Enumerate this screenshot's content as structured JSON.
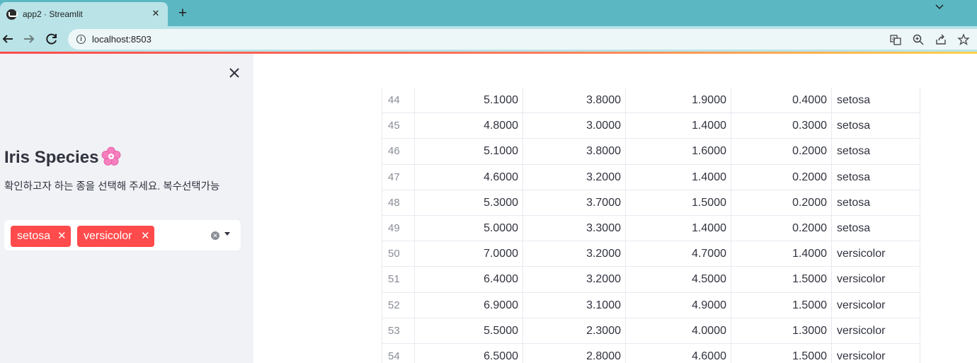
{
  "browser": {
    "tab_title": "app2 · Streamlit",
    "url": "localhost:8503"
  },
  "sidebar": {
    "title": "Iris Species",
    "title_emoji": "cherry-blossom",
    "description": "확인하고자 하는 종을 선택해 주세요. 복수선택가능",
    "multiselect": {
      "selected": [
        "setosa",
        "versicolor"
      ]
    }
  },
  "table": {
    "rows": [
      {
        "idx": "44",
        "c1": "5.1000",
        "c2": "3.8000",
        "c3": "1.9000",
        "c4": "0.4000",
        "species": "setosa"
      },
      {
        "idx": "45",
        "c1": "4.8000",
        "c2": "3.0000",
        "c3": "1.4000",
        "c4": "0.3000",
        "species": "setosa"
      },
      {
        "idx": "46",
        "c1": "5.1000",
        "c2": "3.8000",
        "c3": "1.6000",
        "c4": "0.2000",
        "species": "setosa"
      },
      {
        "idx": "47",
        "c1": "4.6000",
        "c2": "3.2000",
        "c3": "1.4000",
        "c4": "0.2000",
        "species": "setosa"
      },
      {
        "idx": "48",
        "c1": "5.3000",
        "c2": "3.7000",
        "c3": "1.5000",
        "c4": "0.2000",
        "species": "setosa"
      },
      {
        "idx": "49",
        "c1": "5.0000",
        "c2": "3.3000",
        "c3": "1.4000",
        "c4": "0.2000",
        "species": "setosa"
      },
      {
        "idx": "50",
        "c1": "7.0000",
        "c2": "3.2000",
        "c3": "4.7000",
        "c4": "1.4000",
        "species": "versicolor"
      },
      {
        "idx": "51",
        "c1": "6.4000",
        "c2": "3.2000",
        "c3": "4.5000",
        "c4": "1.5000",
        "species": "versicolor"
      },
      {
        "idx": "52",
        "c1": "6.9000",
        "c2": "3.1000",
        "c3": "4.9000",
        "c4": "1.5000",
        "species": "versicolor"
      },
      {
        "idx": "53",
        "c1": "5.5000",
        "c2": "2.3000",
        "c3": "4.0000",
        "c4": "1.3000",
        "species": "versicolor"
      },
      {
        "idx": "54",
        "c1": "6.5000",
        "c2": "2.8000",
        "c3": "4.6000",
        "c4": "1.5000",
        "species": "versicolor"
      }
    ]
  },
  "colors": {
    "accent": "#ff4b4b",
    "sidebar_bg": "#f0f2f6",
    "chrome_tab": "#5bb8c3"
  }
}
